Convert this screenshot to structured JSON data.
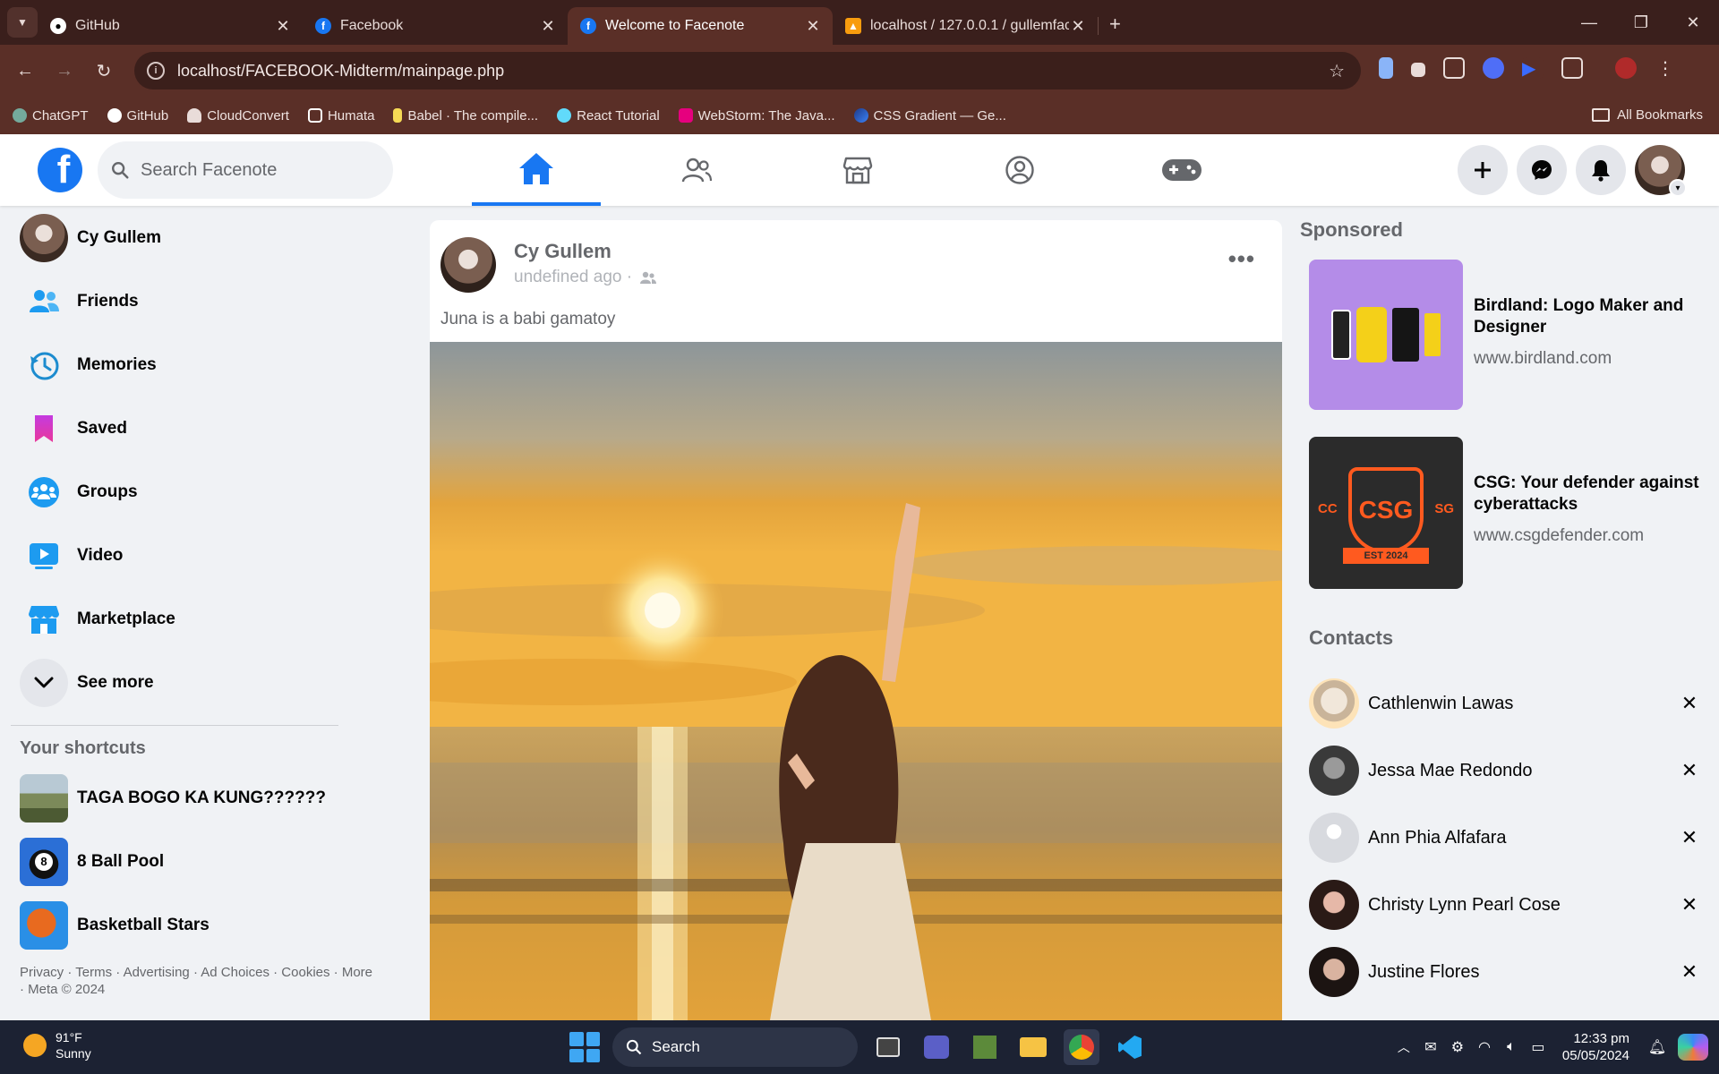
{
  "browser": {
    "tabs": [
      {
        "title": "GitHub",
        "favicon": "github-icon",
        "active": false
      },
      {
        "title": "Facebook",
        "favicon": "facebook-icon",
        "active": false
      },
      {
        "title": "Welcome to Facenote",
        "favicon": "facebook-icon",
        "active": true
      },
      {
        "title": "localhost / 127.0.0.1 / gullemfac",
        "favicon": "phpmyadmin-icon",
        "active": false
      }
    ],
    "url": "localhost/FACEBOOK-Midterm/mainpage.php",
    "bookmarks": [
      {
        "label": "ChatGPT",
        "color": "#74aa9c"
      },
      {
        "label": "GitHub",
        "color": "#ffffff"
      },
      {
        "label": "CloudConvert",
        "color": "#e9dcd9"
      },
      {
        "label": "Humata",
        "color": "#ffffff"
      },
      {
        "label": "Babel · The compile...",
        "color": "#f5da55"
      },
      {
        "label": "React Tutorial",
        "color": "#61dafb"
      },
      {
        "label": "WebStorm: The Java...",
        "color": "#e6007e"
      },
      {
        "label": "CSS Gradient — Ge...",
        "color": "#2b6cb0"
      }
    ],
    "all_bookmarks": "All Bookmarks"
  },
  "header": {
    "search_placeholder": "Search Facenote",
    "accent": "#1877f2"
  },
  "sidebar": {
    "profile_name": "Cy Gullem",
    "items": [
      {
        "label": "Friends",
        "icon": "friends-icon"
      },
      {
        "label": "Memories",
        "icon": "memories-icon"
      },
      {
        "label": "Saved",
        "icon": "saved-icon"
      },
      {
        "label": "Groups",
        "icon": "groups-icon"
      },
      {
        "label": "Video",
        "icon": "video-icon"
      },
      {
        "label": "Marketplace",
        "icon": "marketplace-icon"
      },
      {
        "label": "See more",
        "icon": "chevron-down-icon"
      }
    ],
    "shortcuts_heading": "Your shortcuts",
    "shortcuts": [
      {
        "label": "TAGA BOGO KA KUNG??????"
      },
      {
        "label": "8 Ball Pool"
      },
      {
        "label": "Basketball Stars"
      }
    ],
    "footer": "Privacy · Terms · Advertising · Ad Choices · Cookies · More · Meta © 2024"
  },
  "post": {
    "author": "Cy Gullem",
    "time": "undefined ago ·",
    "text": "Juna is a babi gamatoy"
  },
  "right": {
    "sponsored_heading": "Sponsored",
    "ads": [
      {
        "title": "Birdland: Logo Maker and Designer",
        "url": "www.birdland.com"
      },
      {
        "title": "CSG: Your defender against cyberattacks",
        "url": "www.csgdefender.com",
        "logo_text": "CSG",
        "logo_side_left": "CC",
        "logo_side_right": "SG",
        "logo_ribbon": "EST 2024"
      }
    ],
    "contacts_heading": "Contacts",
    "contacts": [
      {
        "name": "Cathlenwin Lawas"
      },
      {
        "name": "Jessa Mae Redondo"
      },
      {
        "name": "Ann Phia Alfafara"
      },
      {
        "name": "Christy Lynn Pearl Cose"
      },
      {
        "name": "Justine Flores"
      }
    ]
  },
  "taskbar": {
    "temperature": "91°F",
    "condition": "Sunny",
    "search": "Search",
    "time": "12:33 pm",
    "date": "05/05/2024"
  }
}
